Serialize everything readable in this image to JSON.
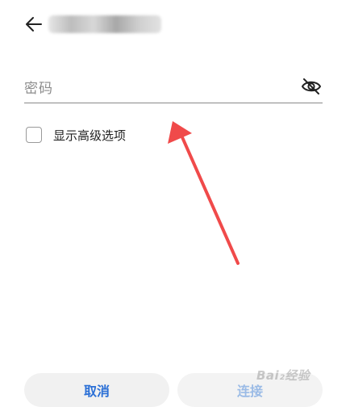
{
  "password": {
    "placeholder": "密码"
  },
  "advanced": {
    "label": "显示高级选项",
    "checked": false
  },
  "buttons": {
    "cancel": "取消",
    "connect": "连接"
  },
  "watermark": {
    "text": "Bai₂经验"
  },
  "colors": {
    "primary": "#2a6fd6",
    "primary_disabled": "#9bbbe6",
    "annotation_arrow": "#f04a4a"
  },
  "icons": {
    "back": "back-arrow-icon",
    "password_toggle": "eye-off-icon"
  }
}
